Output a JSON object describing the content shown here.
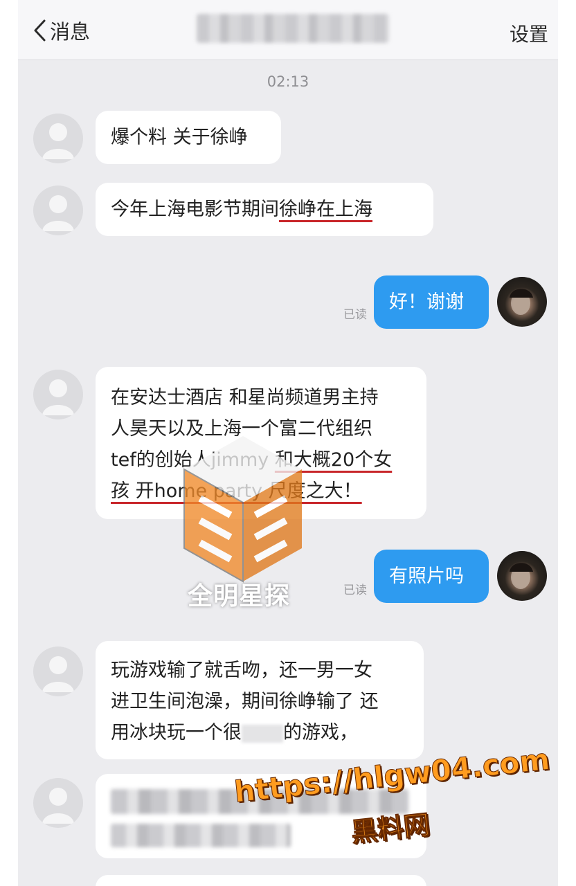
{
  "nav": {
    "back_label": "消息",
    "settings_label": "设置"
  },
  "timestamp": "02:13",
  "messages": [
    {
      "lines": [
        "爆个料 关于徐峥"
      ]
    },
    {
      "prefix": "今年上海电影节期间",
      "underline": "徐峥在上海"
    },
    {
      "lines": [
        "好！谢谢"
      ],
      "read": "已读"
    },
    {
      "line1": "在安达士酒店 和星尚频道男主持",
      "line2": "人昊天以及上海一个富二代组织",
      "line3a": "tef的创始人jimmy ",
      "line3b": "和大概20个女",
      "line4": "孩 开home party 尺度之大！"
    },
    {
      "lines": [
        "有照片吗"
      ],
      "read": "已读"
    },
    {
      "line1": "玩游戏输了就舌吻，还一男一女",
      "line2": "进卫生间泡澡，期间徐峥输了 还",
      "line3a": "用冰块玩一个很",
      "line3b": "的游戏，"
    }
  ],
  "watermark": {
    "text": "全明星探"
  },
  "overlay": {
    "url": "https://hlgw04.com",
    "site": "黑料网"
  },
  "colors": {
    "accent": "#2e9bf0",
    "underline": "#c8262a",
    "overlay": "#ff9c1f"
  }
}
